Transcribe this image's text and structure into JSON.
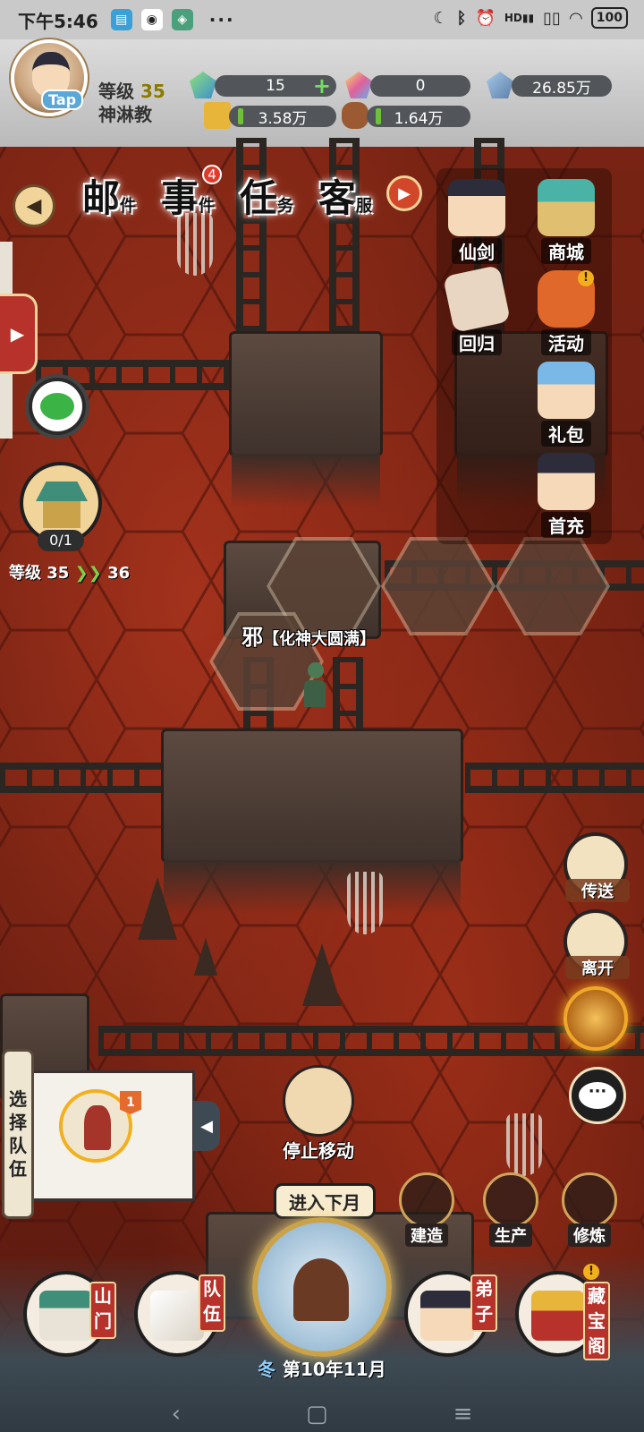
{
  "status_bar": {
    "time": "下午5:46",
    "dots": "···",
    "battery": "100",
    "network": "HD"
  },
  "player": {
    "level_label": "等级",
    "level": "35",
    "sect_name": "神淋教",
    "tap_label": "Tap"
  },
  "resources": {
    "jade": "15",
    "rainbow_jade": "0",
    "crystal": "26.85万",
    "gold": "3.58万",
    "wood": "1.64万"
  },
  "top_tabs": [
    {
      "main": "邮",
      "sub": "件"
    },
    {
      "main": "事",
      "sub": "件",
      "badge": "4"
    },
    {
      "main": "任",
      "sub": "务"
    },
    {
      "main": "客",
      "sub": "服"
    }
  ],
  "right_panel": [
    {
      "label": "仙剑",
      "icon": "sword-fairy-icon"
    },
    {
      "label": "商城",
      "icon": "shop-icon"
    },
    {
      "label": "回归",
      "icon": "return-icon"
    },
    {
      "label": "活动",
      "icon": "lantern-icon",
      "alert": "!"
    },
    {
      "label": "礼包",
      "icon": "gift-pack-icon"
    },
    {
      "label": "首充",
      "icon": "first-charge-icon"
    }
  ],
  "temple": {
    "count": "0/1",
    "level_prefix": "等级",
    "level_from": "35",
    "level_to": "36"
  },
  "map": {
    "evil_mark": "邪",
    "player_rank": "【化神大圆满】"
  },
  "side_actions": [
    {
      "label": "传送",
      "icon": "teleport-map-icon"
    },
    {
      "label": "离开",
      "icon": "leave-icon"
    }
  ],
  "team": {
    "title": "选择队伍",
    "tag": "1"
  },
  "stop_move": {
    "label": "停止移动"
  },
  "next_month": {
    "label": "进入下月"
  },
  "actions": [
    {
      "label": "建造",
      "icon": "hammer-icon"
    },
    {
      "label": "生产",
      "icon": "wheat-icon"
    },
    {
      "label": "修炼",
      "icon": "cultivate-icon"
    }
  ],
  "season": {
    "name": "冬",
    "date": "第10年11月"
  },
  "bottom_nav": [
    {
      "label": "山门",
      "icon": "mountain-gate-icon"
    },
    {
      "label": "队伍",
      "icon": "team-flag-icon"
    },
    {
      "label": "弟子",
      "icon": "disciple-icon"
    },
    {
      "label": "藏宝阁",
      "icon": "treasure-pavilion-icon",
      "alert": "!"
    }
  ],
  "colors": {
    "lava": "#7a2414",
    "accent_gold": "#f2b01e",
    "tag_red": "#b6322a"
  }
}
